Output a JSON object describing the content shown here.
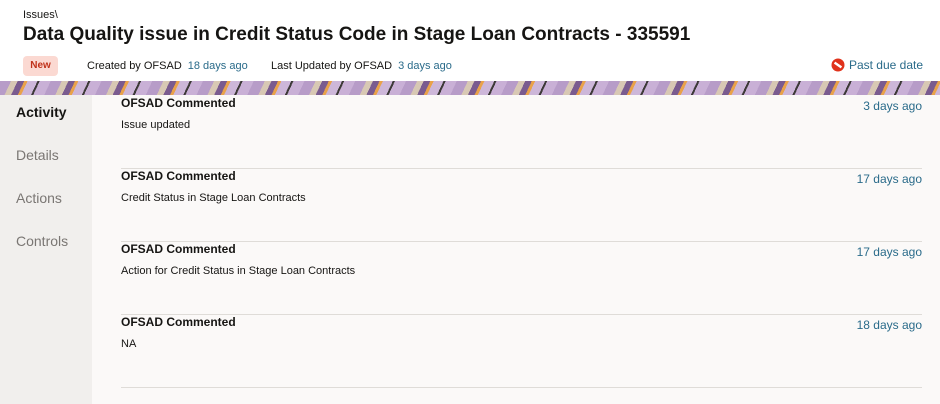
{
  "breadcrumb": "Issues\\",
  "title": "Data Quality issue in Credit Status Code in Stage Loan Contracts - 335591",
  "status_badge": "New",
  "created": {
    "label": "Created by OFSAD",
    "time": "18 days ago"
  },
  "updated": {
    "label": "Last Updated by OFSAD",
    "time": "3 days ago"
  },
  "due": {
    "label": "Past due date",
    "icon": "no-entry-icon",
    "color": "#e0321b"
  },
  "sidebar": {
    "items": [
      {
        "label": "Activity",
        "active": true
      },
      {
        "label": "Details"
      },
      {
        "label": "Actions"
      },
      {
        "label": "Controls"
      }
    ]
  },
  "activity": [
    {
      "who": "OFSAD Commented",
      "message": "Issue updated",
      "time": "3 days ago"
    },
    {
      "who": "OFSAD Commented",
      "message": "Credit Status in Stage Loan Contracts",
      "time": "17 days ago"
    },
    {
      "who": "OFSAD Commented",
      "message": "Action for Credit Status in Stage Loan Contracts",
      "time": "17 days ago"
    },
    {
      "who": "OFSAD Commented",
      "message": "NA",
      "time": "18 days ago"
    }
  ],
  "colors": {
    "link": "#2a6b8a",
    "badge_bg": "#fbd9d2",
    "badge_text": "#c0321b"
  }
}
